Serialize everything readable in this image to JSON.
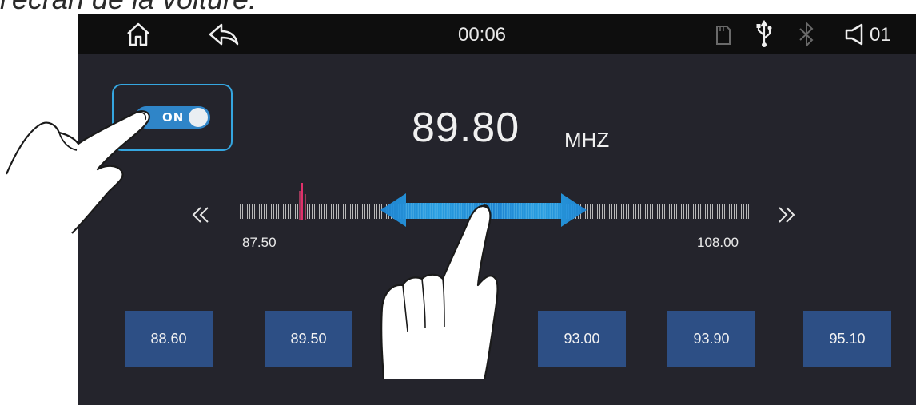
{
  "caption": "l'écran de la voiture.",
  "status_bar": {
    "time": "00:06",
    "volume": "01",
    "icons": [
      "home-icon",
      "back-icon",
      "sd-card-icon",
      "usb-icon",
      "bluetooth-icon",
      "volume-icon"
    ]
  },
  "radio": {
    "power_label": "ON",
    "power_state": "on",
    "frequency": "89.80",
    "unit": "MHZ",
    "range_min": "87.50",
    "range_max": "108.00",
    "presets": [
      "88.60",
      "89.50",
      "",
      "93.00",
      "93.90",
      "95.10"
    ]
  },
  "colors": {
    "accent_blue": "#35a6e0",
    "marker_red": "#e0306a",
    "preset_bg": "#2d4f85",
    "screen_bg": "#24242c"
  },
  "hints": [
    "hand-pointer-toggle",
    "hand-pointer-drag",
    "drag-arrow-icon"
  ]
}
